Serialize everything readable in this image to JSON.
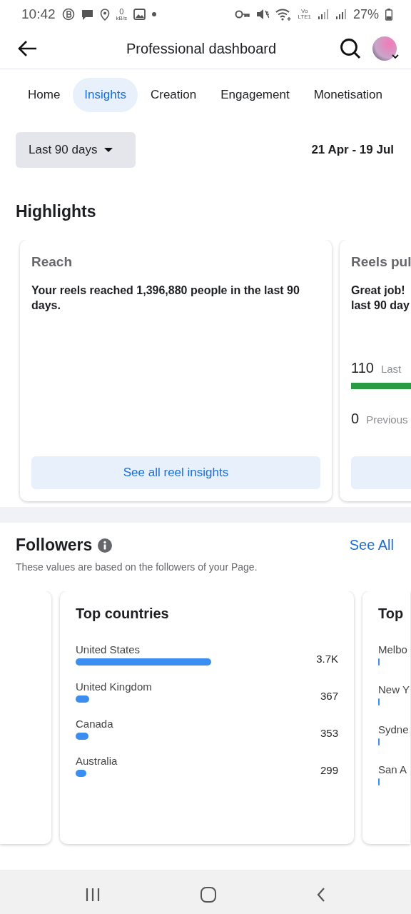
{
  "status_bar": {
    "time": "10:42",
    "speed_value": "0",
    "speed_unit": "kB/s",
    "network_top": "Vo",
    "network_bottom": "LTE1",
    "battery": "27%"
  },
  "app_bar": {
    "title": "Professional dashboard"
  },
  "tabs": [
    {
      "label": "Home",
      "selected": false
    },
    {
      "label": "Insights",
      "selected": true
    },
    {
      "label": "Creation",
      "selected": false
    },
    {
      "label": "Engagement",
      "selected": false
    },
    {
      "label": "Monetisation",
      "selected": false
    }
  ],
  "date_filter": {
    "label": "Last 90 days",
    "range": "21 Apr - 19 Jul"
  },
  "highlights": {
    "title": "Highlights",
    "cards": [
      {
        "kind": "reach",
        "title": "Reach",
        "text": "Your reels reached 1,396,880 people in the last 90 days.",
        "button": "See all reel insights"
      },
      {
        "kind": "reels",
        "title": "Reels pul",
        "text_lines": [
          "Great job!",
          "last 90 day"
        ],
        "current_value": "110",
        "current_label": "Last",
        "previous_value": "0",
        "previous_label": "Previous"
      }
    ]
  },
  "followers": {
    "title": "Followers",
    "see_all": "See All",
    "note": "These values are based on the followers of your Page.",
    "cards": [
      {
        "kind": "empty"
      },
      {
        "kind": "full",
        "title": "Top countries",
        "rows": [
          {
            "name": "United States",
            "value": "3.7K"
          },
          {
            "name": "United Kingdom",
            "value": "367"
          },
          {
            "name": "Canada",
            "value": "353"
          },
          {
            "name": "Australia",
            "value": "299"
          }
        ]
      },
      {
        "kind": "cut",
        "title": "Top",
        "rows": [
          {
            "name": "Melbo"
          },
          {
            "name": "New Y"
          },
          {
            "name": "Sydne"
          },
          {
            "name": "San A"
          }
        ]
      }
    ]
  }
}
